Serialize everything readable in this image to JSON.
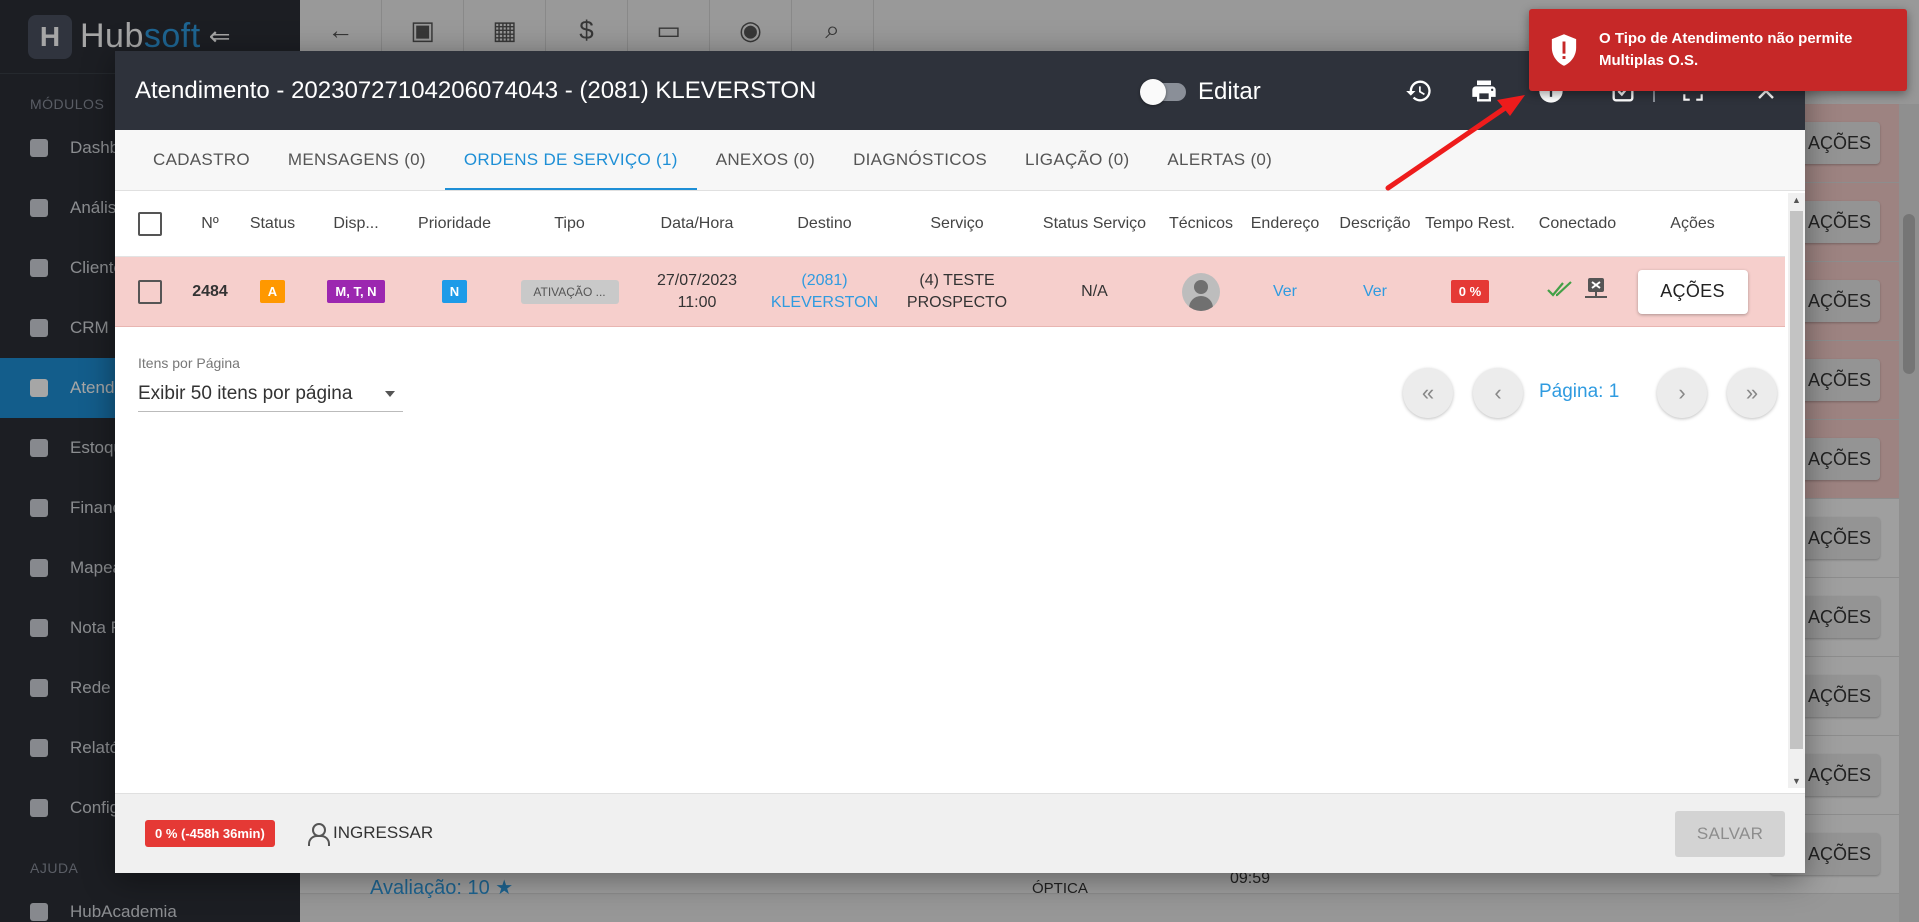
{
  "app": {
    "brand_hub": "Hub",
    "brand_soft": "soft",
    "collapse_glyph": "⇐"
  },
  "sidebar": {
    "section_modules": "MÓDULOS",
    "section_help": "AJUDA",
    "items": [
      {
        "label": "Dashb",
        "icon": "dashboard-icon"
      },
      {
        "label": "Anális",
        "icon": "chart-pie-icon"
      },
      {
        "label": "Cliente",
        "icon": "contact-card-icon"
      },
      {
        "label": "CRM",
        "icon": "crm-board-icon"
      },
      {
        "label": "Atendi",
        "icon": "calendar-clock-icon"
      },
      {
        "label": "Estoqu",
        "icon": "box-icon"
      },
      {
        "label": "Financ",
        "icon": "money-icon"
      },
      {
        "label": "Mapea",
        "icon": "map-pin-icon"
      },
      {
        "label": "Nota F",
        "icon": "invoice-icon"
      },
      {
        "label": "Rede",
        "icon": "server-icon"
      },
      {
        "label": "Relató",
        "icon": "report-icon"
      },
      {
        "label": "Config",
        "icon": "gear-icon"
      }
    ],
    "help_item": "HubAcademia"
  },
  "topbar": {
    "icons": [
      "back-arrow-icon",
      "contact-icon",
      "calendar-icon",
      "dollar-icon",
      "terminal-icon",
      "eye-icon",
      "search-icon"
    ]
  },
  "background": {
    "acoes_label": "AÇÕES",
    "avaliacao": "Avaliação: 10 ★",
    "optica": "ÓPTICA",
    "time": "09:59"
  },
  "modal": {
    "title": "Atendimento - 20230727104206074043 - (2081) KLEVERSTON",
    "edit_label": "Editar",
    "tabs": [
      "CADASTRO",
      "MENSAGENS (0)",
      "ORDENS DE SERVIÇO (1)",
      "ANEXOS (0)",
      "DIAGNÓSTICOS",
      "LIGAÇÃO (0)",
      "ALERTAS (0)"
    ],
    "columns": [
      "Nº",
      "Status",
      "Disp...",
      "Prioridade",
      "Tipo",
      "Data/Hora",
      "Destino",
      "Serviço",
      "Status Serviço",
      "Técnicos",
      "Endereço",
      "Descrição",
      "Tempo Rest.",
      "Conectado",
      "Ações"
    ],
    "row": {
      "numero": "2484",
      "status": "A",
      "disp": "M, T, N",
      "prioridade": "N",
      "tipo": "ATIVAÇÃO ...",
      "data": "27/07/2023",
      "hora": "11:00",
      "destino_1": "(2081)",
      "destino_2": "KLEVERSTON",
      "servico_1": "(4) TESTE",
      "servico_2": "PROSPECTO",
      "status_servico": "N/A",
      "endereco": "Ver",
      "descricao": "Ver",
      "tempo": "0 %",
      "acoes": "AÇÕES"
    },
    "colors": {
      "status": "#ff9800",
      "disp": "#9c27b0",
      "prioridade": "#1e9be8",
      "tempo": "#e53935"
    },
    "pager": {
      "label": "Itens por Página",
      "select_value": "Exibir 50 itens por página",
      "page_label": "Página: 1"
    },
    "footer": {
      "time_badge": "0 % (-458h 36min)",
      "ingressar": "INGRESSAR",
      "salvar": "SALVAR"
    }
  },
  "toast": {
    "message": "O Tipo de Atendimento não permite Multiplas O.S."
  }
}
